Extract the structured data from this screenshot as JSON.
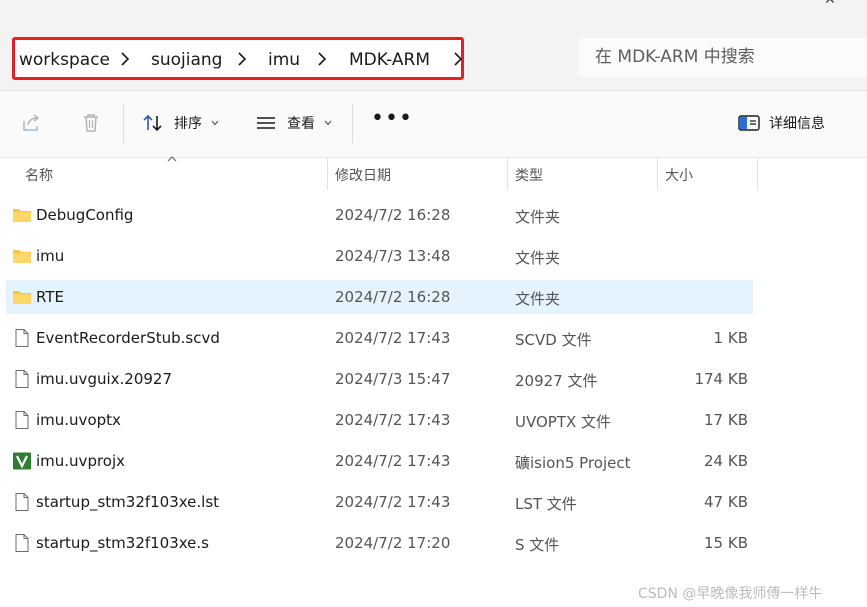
{
  "address_bar": {
    "breadcrumbs": [
      {
        "label": "workspace"
      },
      {
        "label": "suojiang"
      },
      {
        "label": "imu"
      },
      {
        "label": "MDK-ARM"
      }
    ],
    "highlight_color": "#e0202a"
  },
  "search": {
    "placeholder": "在 MDK-ARM 中搜索"
  },
  "toolbar": {
    "sort_label": "排序",
    "view_label": "查看",
    "more_label": "•••",
    "details_label": "详细信息"
  },
  "columns": {
    "name": "名称",
    "date": "修改日期",
    "type": "类型",
    "size": "大小"
  },
  "files": [
    {
      "name": "DebugConfig",
      "date": "2024/7/2 16:28",
      "type": "文件夹",
      "size": "",
      "icon": "folder-icon",
      "selected": false
    },
    {
      "name": "imu",
      "date": "2024/7/3 13:48",
      "type": "文件夹",
      "size": "",
      "icon": "folder-icon",
      "selected": false
    },
    {
      "name": "RTE",
      "date": "2024/7/2 16:28",
      "type": "文件夹",
      "size": "",
      "icon": "folder-icon",
      "selected": true
    },
    {
      "name": "EventRecorderStub.scvd",
      "date": "2024/7/2 17:43",
      "type": "SCVD 文件",
      "size": "1 KB",
      "icon": "file-icon",
      "selected": false
    },
    {
      "name": "imu.uvguix.20927",
      "date": "2024/7/3 15:47",
      "type": "20927 文件",
      "size": "174 KB",
      "icon": "file-icon",
      "selected": false
    },
    {
      "name": "imu.uvoptx",
      "date": "2024/7/2 17:43",
      "type": "UVOPTX 文件",
      "size": "17 KB",
      "icon": "file-icon",
      "selected": false
    },
    {
      "name": "imu.uvprojx",
      "date": "2024/7/2 17:43",
      "type": "礦ision5 Project",
      "size": "24 KB",
      "icon": "keil-project-icon",
      "selected": false
    },
    {
      "name": "startup_stm32f103xe.lst",
      "date": "2024/7/2 17:43",
      "type": "LST 文件",
      "size": "47 KB",
      "icon": "file-icon",
      "selected": false
    },
    {
      "name": "startup_stm32f103xe.s",
      "date": "2024/7/2 17:20",
      "type": "S 文件",
      "size": "15 KB",
      "icon": "file-icon",
      "selected": false
    }
  ],
  "watermark": "CSDN @早晚像我师傅一样牛"
}
